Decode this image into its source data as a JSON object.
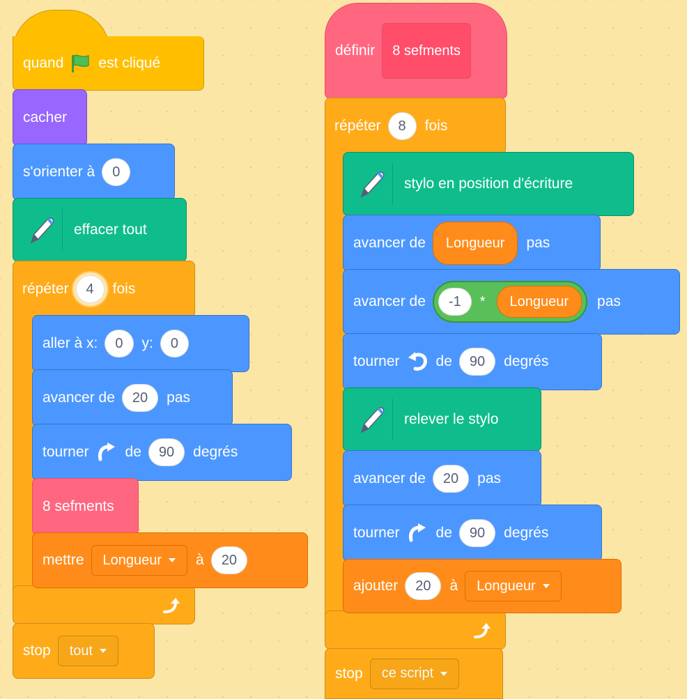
{
  "left": {
    "hat": {
      "text_before": "quand",
      "icon": "green-flag-icon",
      "text_after": "est cliqué"
    },
    "hide": "cacher",
    "point": {
      "label": "s'orienter à",
      "value": "0"
    },
    "erase": "effacer tout",
    "repeat": {
      "label": "répéter",
      "value": "4",
      "suffix": "fois"
    },
    "goto": {
      "label": "aller à x:",
      "x": "0",
      "ylabel": "y:",
      "y": "0"
    },
    "move": {
      "label": "avancer de",
      "value": "20",
      "suffix": "pas"
    },
    "turn": {
      "label": "tourner",
      "icon": "rotate-right-icon",
      "de": "de",
      "value": "90",
      "suffix": "degrés"
    },
    "call": "8 sefments",
    "setvar": {
      "label": "mettre",
      "var": "Longueur",
      "to": "à",
      "value": "20"
    },
    "stop": {
      "label": "stop",
      "option": "tout"
    }
  },
  "right": {
    "define": {
      "label": "définir",
      "name": "8 sefments"
    },
    "repeat": {
      "label": "répéter",
      "value": "8",
      "suffix": "fois"
    },
    "pendown": "stylo en position d'écriture",
    "move1": {
      "label": "avancer de",
      "reporter": "Longueur",
      "suffix": "pas"
    },
    "move2": {
      "label": "avancer de",
      "num": "-1",
      "op": "*",
      "reporter": "Longueur",
      "suffix": "pas"
    },
    "turnleft": {
      "label": "tourner",
      "icon": "rotate-left-icon",
      "de": "de",
      "value": "90",
      "suffix": "degrés"
    },
    "penup": "relever le stylo",
    "move3": {
      "label": "avancer de",
      "value": "20",
      "suffix": "pas"
    },
    "turnright": {
      "label": "tourner",
      "icon": "rotate-right-icon",
      "de": "de",
      "value": "90",
      "suffix": "degrés"
    },
    "change": {
      "label": "ajouter",
      "value": "20",
      "to": "à",
      "var": "Longueur"
    },
    "stop": {
      "label": "stop",
      "option": "ce script"
    }
  },
  "colors": {
    "background": "#fbe6a6",
    "events": "#ffbf00",
    "looks": "#9966ff",
    "motion": "#4c97ff",
    "pen": "#0fbd8c",
    "control": "#ffab19",
    "variables": "#ff8c1a",
    "my_blocks": "#ff6680",
    "operators": "#59c059"
  }
}
